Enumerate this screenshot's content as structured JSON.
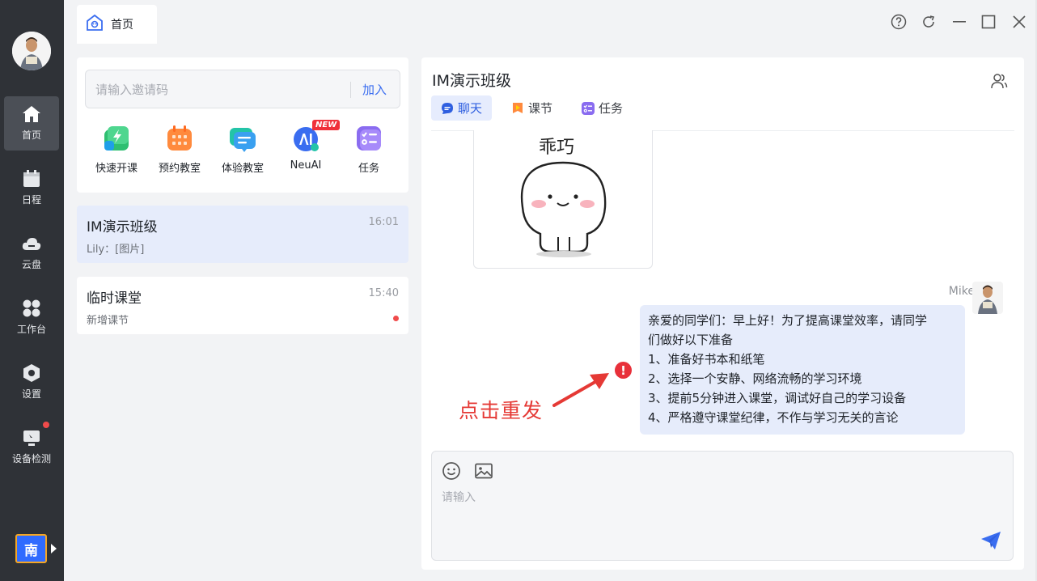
{
  "window": {
    "tab_home": "首页"
  },
  "rail": {
    "items": [
      {
        "label": "首页",
        "icon": "home-icon"
      },
      {
        "label": "日程",
        "icon": "calendar-icon"
      },
      {
        "label": "云盘",
        "icon": "cloud-icon"
      },
      {
        "label": "工作台",
        "icon": "grid-icon"
      },
      {
        "label": "设置",
        "icon": "settings-icon"
      },
      {
        "label": "设备检测",
        "icon": "device-check-icon"
      }
    ],
    "lang_button": "南"
  },
  "invite": {
    "placeholder": "请输入邀请码",
    "join_label": "加入"
  },
  "apps": [
    {
      "label": "快速开课",
      "icon": "quick-class-icon",
      "color": "#2fbf71"
    },
    {
      "label": "预约教室",
      "icon": "book-classroom-icon",
      "color": "#ff8a3d"
    },
    {
      "label": "体验教室",
      "icon": "trial-classroom-icon",
      "color": "#23c4a8"
    },
    {
      "label": "NeuAI",
      "icon": "neuai-icon",
      "color": "#3a6df0",
      "badge": "NEW"
    },
    {
      "label": "任务",
      "icon": "task-icon",
      "color": "#8a6cf0"
    }
  ],
  "conversations": [
    {
      "name": "IM演示班级",
      "preview": "Lily：[图片]",
      "time": "16:01",
      "active": true
    },
    {
      "name": "临时课堂",
      "preview": "新增课节",
      "time": "15:40",
      "unread": true
    }
  ],
  "chat": {
    "title": "IM演示班级",
    "tabs": [
      {
        "label": "聊天",
        "icon": "chat-icon"
      },
      {
        "label": "课节",
        "icon": "lesson-icon"
      },
      {
        "label": "任务",
        "icon": "task-icon"
      }
    ],
    "sticker_text": "乖巧",
    "sender": "Mike",
    "message_lines": [
      "亲爱的同学们：早上好！为了提高课堂效率，请同学",
      "们做好以下准备",
      "1、准备好书本和纸笔",
      "2、选择一个安静、网络流畅的学习环境",
      "3、提前5分钟进入课堂，调试好自己的学习设备",
      "4、严格遵守课堂纪律，不作与学习无关的言论"
    ],
    "error_mark": "!",
    "resend_note": "点击重发",
    "input_placeholder": "请输入"
  },
  "colors": {
    "accent": "#3a6df0",
    "rail_bg": "#2f3237",
    "error": "#e8303a"
  }
}
